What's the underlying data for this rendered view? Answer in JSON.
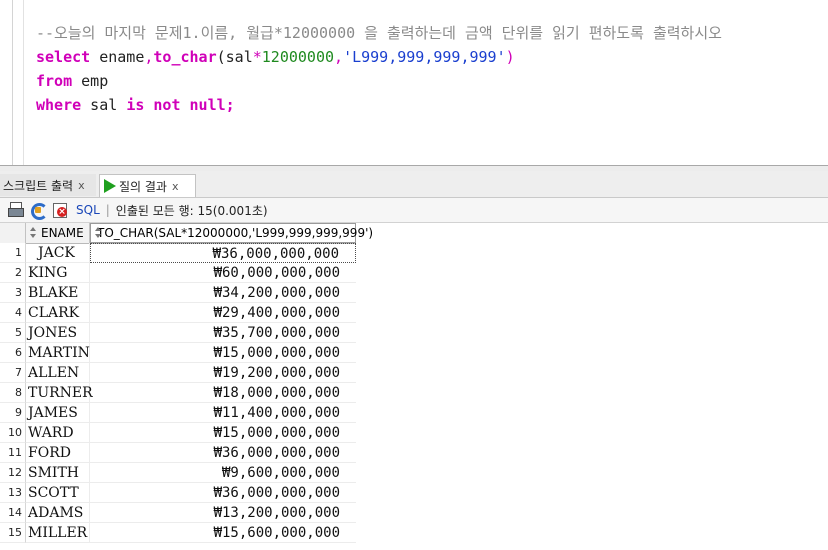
{
  "editor": {
    "lines": [
      [
        {
          "t": "--오늘의 마지막 문제1.이름, 월급*12000000 을 출력하는데 금액 단위를 읽기 편하도록 출력하시오",
          "c": "comment"
        }
      ],
      [
        {
          "t": "select",
          "c": "kw"
        },
        {
          "t": " ename",
          "c": "id"
        },
        {
          "t": ",",
          "c": "op"
        },
        {
          "t": "to_char",
          "c": "fn"
        },
        {
          "t": "(sal",
          "c": "id"
        },
        {
          "t": "*",
          "c": "op"
        },
        {
          "t": "12000000",
          "c": "num"
        },
        {
          "t": ",",
          "c": "op"
        },
        {
          "t": "'L999,999,999,999'",
          "c": "str"
        },
        {
          "t": ")",
          "c": "op"
        }
      ],
      [
        {
          "t": "from",
          "c": "kw"
        },
        {
          "t": " emp",
          "c": "id"
        }
      ],
      [
        {
          "t": "where",
          "c": "kw"
        },
        {
          "t": " sal ",
          "c": "id"
        },
        {
          "t": "is not null;",
          "c": "kw"
        }
      ]
    ]
  },
  "tabs": {
    "script_output": {
      "label": "스크립트 출력",
      "close": "x"
    },
    "query_result": {
      "label": "질의 결과",
      "close": "x"
    }
  },
  "toolbar": {
    "sql_label": "SQL",
    "separator": "|",
    "status": "인출된 모든 행: 15(0.001초)"
  },
  "grid": {
    "columns": [
      "ENAME",
      "TO_CHAR(SAL*12000000,'L999,999,999,999')"
    ],
    "rows": [
      {
        "num": "1",
        "ename": "JACK",
        "value": "₩36,000,000,000"
      },
      {
        "num": "2",
        "ename": "KING",
        "value": "₩60,000,000,000"
      },
      {
        "num": "3",
        "ename": "BLAKE",
        "value": "₩34,200,000,000"
      },
      {
        "num": "4",
        "ename": "CLARK",
        "value": "₩29,400,000,000"
      },
      {
        "num": "5",
        "ename": "JONES",
        "value": "₩35,700,000,000"
      },
      {
        "num": "6",
        "ename": "MARTIN",
        "value": "₩15,000,000,000"
      },
      {
        "num": "7",
        "ename": "ALLEN",
        "value": "₩19,200,000,000"
      },
      {
        "num": "8",
        "ename": "TURNER",
        "value": "₩18,000,000,000"
      },
      {
        "num": "9",
        "ename": "JAMES",
        "value": "₩11,400,000,000"
      },
      {
        "num": "10",
        "ename": "WARD",
        "value": "₩15,000,000,000"
      },
      {
        "num": "11",
        "ename": "FORD",
        "value": "₩36,000,000,000"
      },
      {
        "num": "12",
        "ename": "SMITH",
        "value": "₩9,600,000,000"
      },
      {
        "num": "13",
        "ename": "SCOTT",
        "value": "₩36,000,000,000"
      },
      {
        "num": "14",
        "ename": "ADAMS",
        "value": "₩13,200,000,000"
      },
      {
        "num": "15",
        "ename": "MILLER",
        "value": "₩15,600,000,000"
      }
    ]
  }
}
